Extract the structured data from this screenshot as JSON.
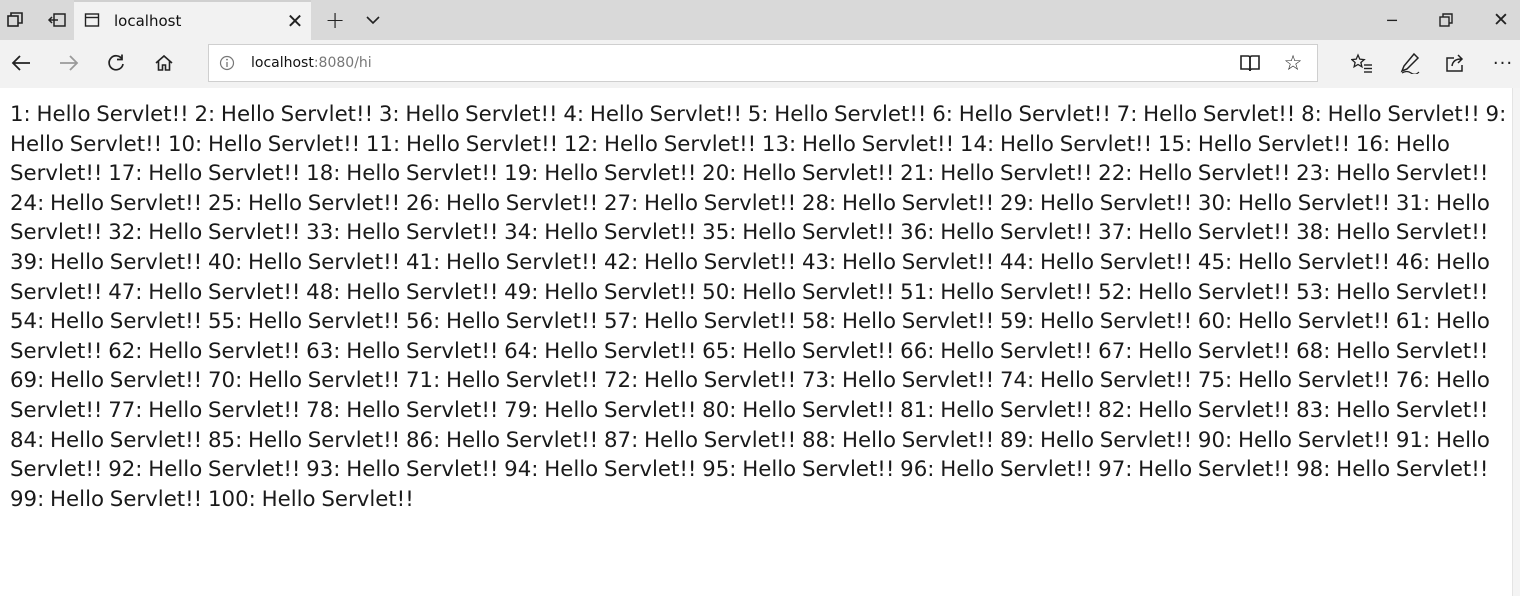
{
  "tab": {
    "title": "localhost",
    "close_glyph": "✕"
  },
  "titlebar": {
    "new_tab_glyph": "+",
    "minimize_glyph": "─",
    "close_glyph": "✕"
  },
  "address": {
    "host": "localhost",
    "path": ":8080/hi"
  },
  "toolbar": {
    "more_glyph": "···"
  },
  "icons": {
    "tab_actions": "tab-actions-icon",
    "set_aside": "set-aside-tabs-icon",
    "page": "page-icon",
    "new_tab": "plus-icon",
    "tab_preview": "chevron-down-icon",
    "back": "arrow-left-icon",
    "forward": "arrow-right-icon",
    "refresh": "refresh-icon",
    "home": "home-icon",
    "info": "info-icon",
    "reading_view": "book-icon",
    "favorite": "star-icon",
    "favorites_hub": "favorites-list-icon",
    "notes": "pen-icon",
    "share": "share-icon",
    "more": "more-icon"
  },
  "content": {
    "text": "1: Hello Servlet!! 2: Hello Servlet!! 3: Hello Servlet!! 4: Hello Servlet!! 5: Hello Servlet!! 6: Hello Servlet!! 7: Hello Servlet!! 8: Hello Servlet!! 9: Hello Servlet!! 10: Hello Servlet!! 11: Hello Servlet!! 12: Hello Servlet!! 13: Hello Servlet!! 14: Hello Servlet!! 15: Hello Servlet!! 16: Hello Servlet!! 17: Hello Servlet!! 18: Hello Servlet!! 19: Hello Servlet!! 20: Hello Servlet!! 21: Hello Servlet!! 22: Hello Servlet!! 23: Hello Servlet!! 24: Hello Servlet!! 25: Hello Servlet!! 26: Hello Servlet!! 27: Hello Servlet!! 28: Hello Servlet!! 29: Hello Servlet!! 30: Hello Servlet!! 31: Hello Servlet!! 32: Hello Servlet!! 33: Hello Servlet!! 34: Hello Servlet!! 35: Hello Servlet!! 36: Hello Servlet!! 37: Hello Servlet!! 38: Hello Servlet!! 39: Hello Servlet!! 40: Hello Servlet!! 41: Hello Servlet!! 42: Hello Servlet!! 43: Hello Servlet!! 44: Hello Servlet!! 45: Hello Servlet!! 46: Hello Servlet!! 47: Hello Servlet!! 48: Hello Servlet!! 49: Hello Servlet!! 50: Hello Servlet!! 51: Hello Servlet!! 52: Hello Servlet!! 53: Hello Servlet!! 54: Hello Servlet!! 55: Hello Servlet!! 56: Hello Servlet!! 57: Hello Servlet!! 58: Hello Servlet!! 59: Hello Servlet!! 60: Hello Servlet!! 61: Hello Servlet!! 62: Hello Servlet!! 63: Hello Servlet!! 64: Hello Servlet!! 65: Hello Servlet!! 66: Hello Servlet!! 67: Hello Servlet!! 68: Hello Servlet!! 69: Hello Servlet!! 70: Hello Servlet!! 71: Hello Servlet!! 72: Hello Servlet!! 73: Hello Servlet!! 74: Hello Servlet!! 75: Hello Servlet!! 76: Hello Servlet!! 77: Hello Servlet!! 78: Hello Servlet!! 79: Hello Servlet!! 80: Hello Servlet!! 81: Hello Servlet!! 82: Hello Servlet!! 83: Hello Servlet!! 84: Hello Servlet!! 85: Hello Servlet!! 86: Hello Servlet!! 87: Hello Servlet!! 88: Hello Servlet!! 89: Hello Servlet!! 90: Hello Servlet!! 91: Hello Servlet!! 92: Hello Servlet!! 93: Hello Servlet!! 94: Hello Servlet!! 95: Hello Servlet!! 96: Hello Servlet!! 97: Hello Servlet!! 98: Hello Servlet!! 99: Hello Servlet!! 100: Hello Servlet!!"
  }
}
